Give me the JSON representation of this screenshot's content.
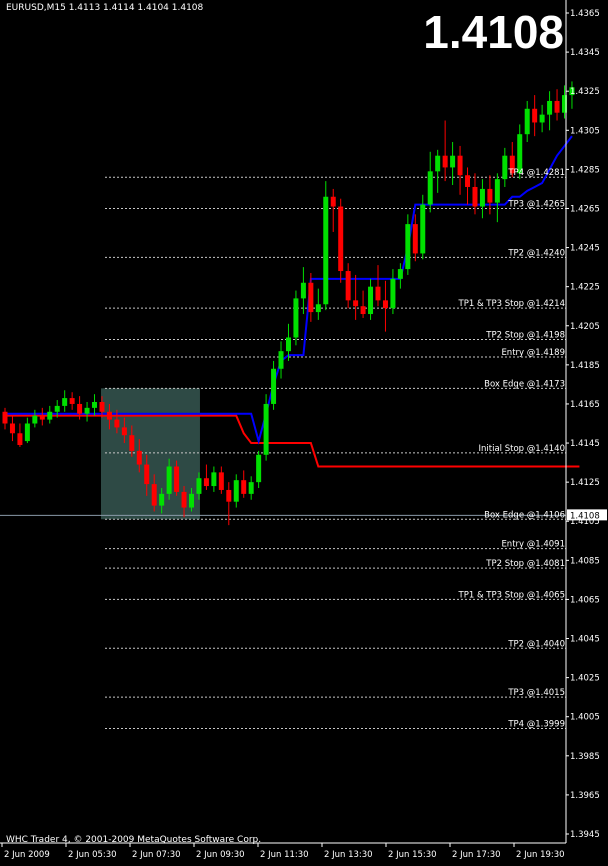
{
  "window": {
    "symbol_line": "EURUSD,M15  1.4113 1.4114 1.4104 1.4108",
    "big_price": "1.4108",
    "copyright": "WHC Trader 4, © 2001-2009 MetaQuotes Software Corp."
  },
  "chart_data": {
    "type": "candlestick",
    "symbol": "EURUSD",
    "timeframe": "M15",
    "ohlc_current": {
      "open": 1.4113,
      "high": 1.4114,
      "low": 1.4104,
      "close": 1.4108
    },
    "y_range": [
      1.3935,
      1.4367
    ],
    "y_ticks": [
      "1.4365",
      "1.4345",
      "1.4325",
      "1.4305",
      "1.4285",
      "1.4265",
      "1.4245",
      "1.4225",
      "1.4205",
      "1.4185",
      "1.4165",
      "1.4145",
      "1.4125",
      "1.4105",
      "1.4085",
      "1.4065",
      "1.4045",
      "1.4025",
      "1.4005",
      "1.3985",
      "1.3965",
      "1.3945"
    ],
    "x_labels": [
      "2 Jun 2009",
      "2 Jun 05:30",
      "2 Jun 07:30",
      "2 Jun 09:30",
      "2 Jun 11:30",
      "2 Jun 13:30",
      "2 Jun 15:30",
      "2 Jun 17:30",
      "2 Jun 19:30"
    ],
    "current_price_label": "1.4108",
    "levels": [
      {
        "label": "TP4 @1.4281",
        "price": 1.4281
      },
      {
        "label": "TP3 @1.4265",
        "price": 1.4265
      },
      {
        "label": "TP2 @1.4240",
        "price": 1.424
      },
      {
        "label": "TP1 & TP3 Stop @1.4214",
        "price": 1.4214
      },
      {
        "label": "TP2 Stop @1.4198",
        "price": 1.4198
      },
      {
        "label": "Entry @1.4189",
        "price": 1.4189
      },
      {
        "label": "Box Edge @1.4173",
        "price": 1.4173
      },
      {
        "label": "Initial Stop @1.4140",
        "price": 1.414
      },
      {
        "label": "Box Edge @1.4106",
        "price": 1.4106
      },
      {
        "label": "Entry @1.4091",
        "price": 1.4091
      },
      {
        "label": "TP2 Stop @1.4081",
        "price": 1.4081
      },
      {
        "label": "TP1 & TP3 Stop @1.4065",
        "price": 1.4065
      },
      {
        "label": "TP2 @1.4040",
        "price": 1.404
      },
      {
        "label": "TP3 @1.4015",
        "price": 1.4015
      },
      {
        "label": "TP4 @1.3999",
        "price": 1.3999
      }
    ],
    "box": {
      "from_index": 13,
      "to_index": 26,
      "high": 1.4173,
      "low": 1.4106
    },
    "candles": [
      [
        1.4161,
        1.4163,
        1.4152,
        1.4155
      ],
      [
        1.4155,
        1.4159,
        1.4146,
        1.415
      ],
      [
        1.415,
        1.4155,
        1.4143,
        1.4144
      ],
      [
        1.4146,
        1.4158,
        1.4145,
        1.4155
      ],
      [
        1.4155,
        1.4162,
        1.4153,
        1.4159
      ],
      [
        1.4159,
        1.4163,
        1.4154,
        1.4157
      ],
      [
        1.4157,
        1.4164,
        1.4155,
        1.4161
      ],
      [
        1.4161,
        1.4167,
        1.4158,
        1.4164
      ],
      [
        1.4164,
        1.4172,
        1.4161,
        1.4168
      ],
      [
        1.4168,
        1.4171,
        1.4162,
        1.4165
      ],
      [
        1.4165,
        1.4169,
        1.4157,
        1.416
      ],
      [
        1.416,
        1.4166,
        1.4156,
        1.4163
      ],
      [
        1.4163,
        1.417,
        1.4159,
        1.4166
      ],
      [
        1.4166,
        1.4169,
        1.4158,
        1.4161
      ],
      [
        1.4161,
        1.4165,
        1.4152,
        1.4157
      ],
      [
        1.4157,
        1.4162,
        1.415,
        1.4153
      ],
      [
        1.4153,
        1.4158,
        1.4145,
        1.4149
      ],
      [
        1.4149,
        1.4154,
        1.4138,
        1.4141
      ],
      [
        1.4141,
        1.4147,
        1.413,
        1.4134
      ],
      [
        1.4134,
        1.4139,
        1.4118,
        1.4124
      ],
      [
        1.4124,
        1.4129,
        1.411,
        1.4113
      ],
      [
        1.4113,
        1.4122,
        1.4109,
        1.4119
      ],
      [
        1.4119,
        1.4137,
        1.4116,
        1.4133
      ],
      [
        1.4133,
        1.4136,
        1.4118,
        1.412
      ],
      [
        1.412,
        1.4123,
        1.4107,
        1.4112
      ],
      [
        1.4112,
        1.4122,
        1.411,
        1.4119
      ],
      [
        1.4119,
        1.413,
        1.4116,
        1.4127
      ],
      [
        1.4127,
        1.4134,
        1.4121,
        1.4123
      ],
      [
        1.4123,
        1.4133,
        1.412,
        1.413
      ],
      [
        1.413,
        1.4133,
        1.4119,
        1.4121
      ],
      [
        1.4121,
        1.4125,
        1.4103,
        1.4115
      ],
      [
        1.4115,
        1.4129,
        1.4112,
        1.4126
      ],
      [
        1.4126,
        1.4131,
        1.4117,
        1.4119
      ],
      [
        1.4119,
        1.4128,
        1.4116,
        1.4125
      ],
      [
        1.4125,
        1.4141,
        1.4122,
        1.4139
      ],
      [
        1.4139,
        1.417,
        1.4136,
        1.4165
      ],
      [
        1.4165,
        1.4187,
        1.4162,
        1.4183
      ],
      [
        1.4183,
        1.4197,
        1.4178,
        1.4192
      ],
      [
        1.4192,
        1.4206,
        1.4187,
        1.4199
      ],
      [
        1.4199,
        1.4223,
        1.4195,
        1.4219
      ],
      [
        1.4219,
        1.4235,
        1.4211,
        1.4227
      ],
      [
        1.4227,
        1.4232,
        1.4207,
        1.4212
      ],
      [
        1.4212,
        1.4224,
        1.4208,
        1.4216
      ],
      [
        1.4216,
        1.4279,
        1.4213,
        1.4271
      ],
      [
        1.4271,
        1.4275,
        1.4253,
        1.4266
      ],
      [
        1.4266,
        1.427,
        1.4227,
        1.4233
      ],
      [
        1.4233,
        1.4237,
        1.4214,
        1.4218
      ],
      [
        1.4218,
        1.4231,
        1.4208,
        1.4215
      ],
      [
        1.4215,
        1.4223,
        1.4209,
        1.4211
      ],
      [
        1.4211,
        1.4229,
        1.4208,
        1.4225
      ],
      [
        1.4225,
        1.4236,
        1.4215,
        1.4218
      ],
      [
        1.4218,
        1.4228,
        1.4202,
        1.4214
      ],
      [
        1.4214,
        1.4234,
        1.4211,
        1.4229
      ],
      [
        1.4229,
        1.4237,
        1.4224,
        1.4234
      ],
      [
        1.4234,
        1.4262,
        1.4231,
        1.4257
      ],
      [
        1.4257,
        1.4262,
        1.4238,
        1.4242
      ],
      [
        1.4242,
        1.4272,
        1.4239,
        1.4267
      ],
      [
        1.4267,
        1.4294,
        1.4263,
        1.4284
      ],
      [
        1.4284,
        1.4295,
        1.4273,
        1.4292
      ],
      [
        1.4292,
        1.431,
        1.4279,
        1.4286
      ],
      [
        1.4286,
        1.4299,
        1.4277,
        1.4292
      ],
      [
        1.4292,
        1.4297,
        1.4272,
        1.4282
      ],
      [
        1.4282,
        1.4286,
        1.4267,
        1.4276
      ],
      [
        1.4276,
        1.4283,
        1.4262,
        1.4266
      ],
      [
        1.4266,
        1.428,
        1.426,
        1.4275
      ],
      [
        1.4275,
        1.4282,
        1.4262,
        1.4268
      ],
      [
        1.4268,
        1.4283,
        1.4258,
        1.428
      ],
      [
        1.428,
        1.4296,
        1.4276,
        1.4292
      ],
      [
        1.4292,
        1.4299,
        1.4281,
        1.4283
      ],
      [
        1.4283,
        1.4308,
        1.428,
        1.4303
      ],
      [
        1.4303,
        1.432,
        1.4299,
        1.4316
      ],
      [
        1.4316,
        1.4323,
        1.4302,
        1.4309
      ],
      [
        1.4309,
        1.4318,
        1.4304,
        1.4313
      ],
      [
        1.4313,
        1.4325,
        1.4305,
        1.432
      ],
      [
        1.432,
        1.4326,
        1.431,
        1.4314
      ],
      [
        1.4314,
        1.4328,
        1.4311,
        1.4323
      ],
      [
        1.4323,
        1.433,
        1.4316,
        1.4327
      ]
    ],
    "support_line": [
      1.416,
      1.416,
      1.416,
      1.416,
      1.416,
      1.416,
      1.416,
      1.416,
      1.416,
      1.416,
      1.416,
      1.416,
      1.416,
      1.416,
      1.416,
      1.416,
      1.416,
      1.416,
      1.416,
      1.416,
      1.416,
      1.416,
      1.416,
      1.416,
      1.416,
      1.416,
      1.416,
      1.416,
      1.416,
      1.416,
      1.416,
      1.416,
      1.416,
      1.416,
      1.4146,
      1.416,
      1.4175,
      1.4187,
      1.419,
      1.419,
      1.419,
      1.4229,
      1.4229,
      1.4229,
      1.4229,
      1.4229,
      1.4229,
      1.4229,
      1.4229,
      1.4229,
      1.4229,
      1.4229,
      1.4229,
      1.4229,
      1.4245,
      1.4267,
      1.4267,
      1.4267,
      1.4267,
      1.4267,
      1.4267,
      1.4267,
      1.4267,
      1.4267,
      1.4267,
      1.4267,
      1.4267,
      1.4267,
      1.4271,
      1.4271,
      1.4274,
      1.4276,
      1.4278,
      1.4285,
      1.4292,
      1.4297,
      1.4302
    ],
    "resistance_line": [
      1.4159,
      1.4159,
      1.4159,
      1.4159,
      1.4159,
      1.4159,
      1.4159,
      1.4159,
      1.4159,
      1.4159,
      1.4159,
      1.4159,
      1.4159,
      1.4159,
      1.4159,
      1.4159,
      1.4159,
      1.4159,
      1.4159,
      1.4159,
      1.4159,
      1.4159,
      1.4159,
      1.4159,
      1.4159,
      1.4159,
      1.4159,
      1.4159,
      1.4159,
      1.4159,
      1.4159,
      1.4159,
      1.415,
      1.4145,
      1.4145,
      1.4145,
      1.4145,
      1.4145,
      1.4145,
      1.4145,
      1.4145,
      1.4145,
      1.4133,
      1.4133,
      1.4133,
      1.4133,
      1.4133,
      1.4133,
      1.4133,
      1.4133,
      1.4133,
      1.4133,
      1.4133,
      1.4133,
      1.4133,
      1.4133,
      1.4133,
      1.4133,
      1.4133,
      1.4133,
      1.4133,
      1.4133,
      1.4133,
      1.4133,
      1.4133,
      1.4133,
      1.4133,
      1.4133,
      1.4133,
      1.4133,
      1.4133,
      1.4133,
      1.4133,
      1.4133,
      1.4133,
      1.4133,
      1.4133,
      1.4133
    ]
  }
}
